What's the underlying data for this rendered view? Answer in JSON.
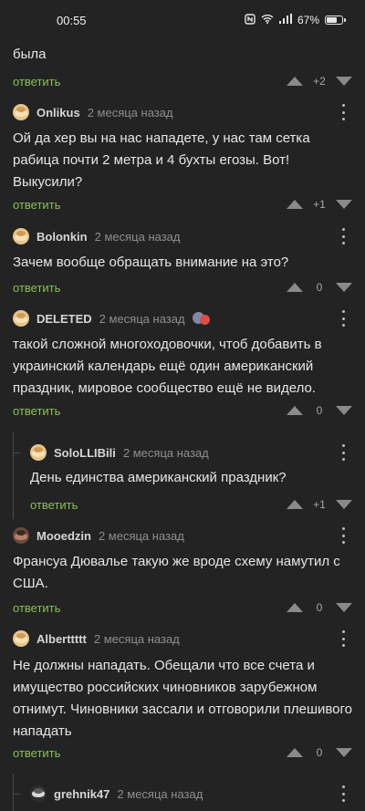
{
  "status": {
    "time": "00:55",
    "battery": "67%",
    "icons": [
      "nfc-icon",
      "wifi-icon",
      "signal-icon",
      "battery-icon"
    ]
  },
  "comments": [
    {
      "text": "была",
      "reply": "ответить",
      "score": "+2"
    },
    {
      "user": "Onlikus",
      "date": "2 месяца назад",
      "text": "Ой да хер вы на нас нападете, у нас там сетка рабица почти 2 метра и 4 бухты егозы. Вот! Выкусили?",
      "reply": "ответить",
      "score": "+1"
    },
    {
      "user": "Bolonkin",
      "date": "2 месяца назад",
      "text": "Зачем вообще обращать внимание на это?",
      "reply": "ответить",
      "score": "0"
    },
    {
      "user": "DELETED",
      "date": "2 месяца назад",
      "text": "такой сложной многоходовочки, чтоб добавить в украинский календарь ещё один американский праздник, мировое сообщество ещё не видело.",
      "reply": "ответить",
      "score": "0"
    },
    {
      "user": "SoloLLIBili",
      "date": "2 месяца назад",
      "text": "День единства американский праздник?",
      "reply": "ответить",
      "score": "+1"
    },
    {
      "user": "Mooedzin",
      "date": "2 месяца назад",
      "text": "Франсуа Дювалье такую же вроде схему намутил с США.",
      "reply": "ответить",
      "score": "0"
    },
    {
      "user": "Alberttttt",
      "date": "2 месяца назад",
      "text": "Не должны нападать. Обещали что все счета и имущество российских чиновников зарубежном отнимут. Чиновники зассали и отговорили плешивого нападать",
      "reply": "ответить",
      "score": "0"
    },
    {
      "user": "grehnik47",
      "date": "2 месяца назад"
    }
  ]
}
